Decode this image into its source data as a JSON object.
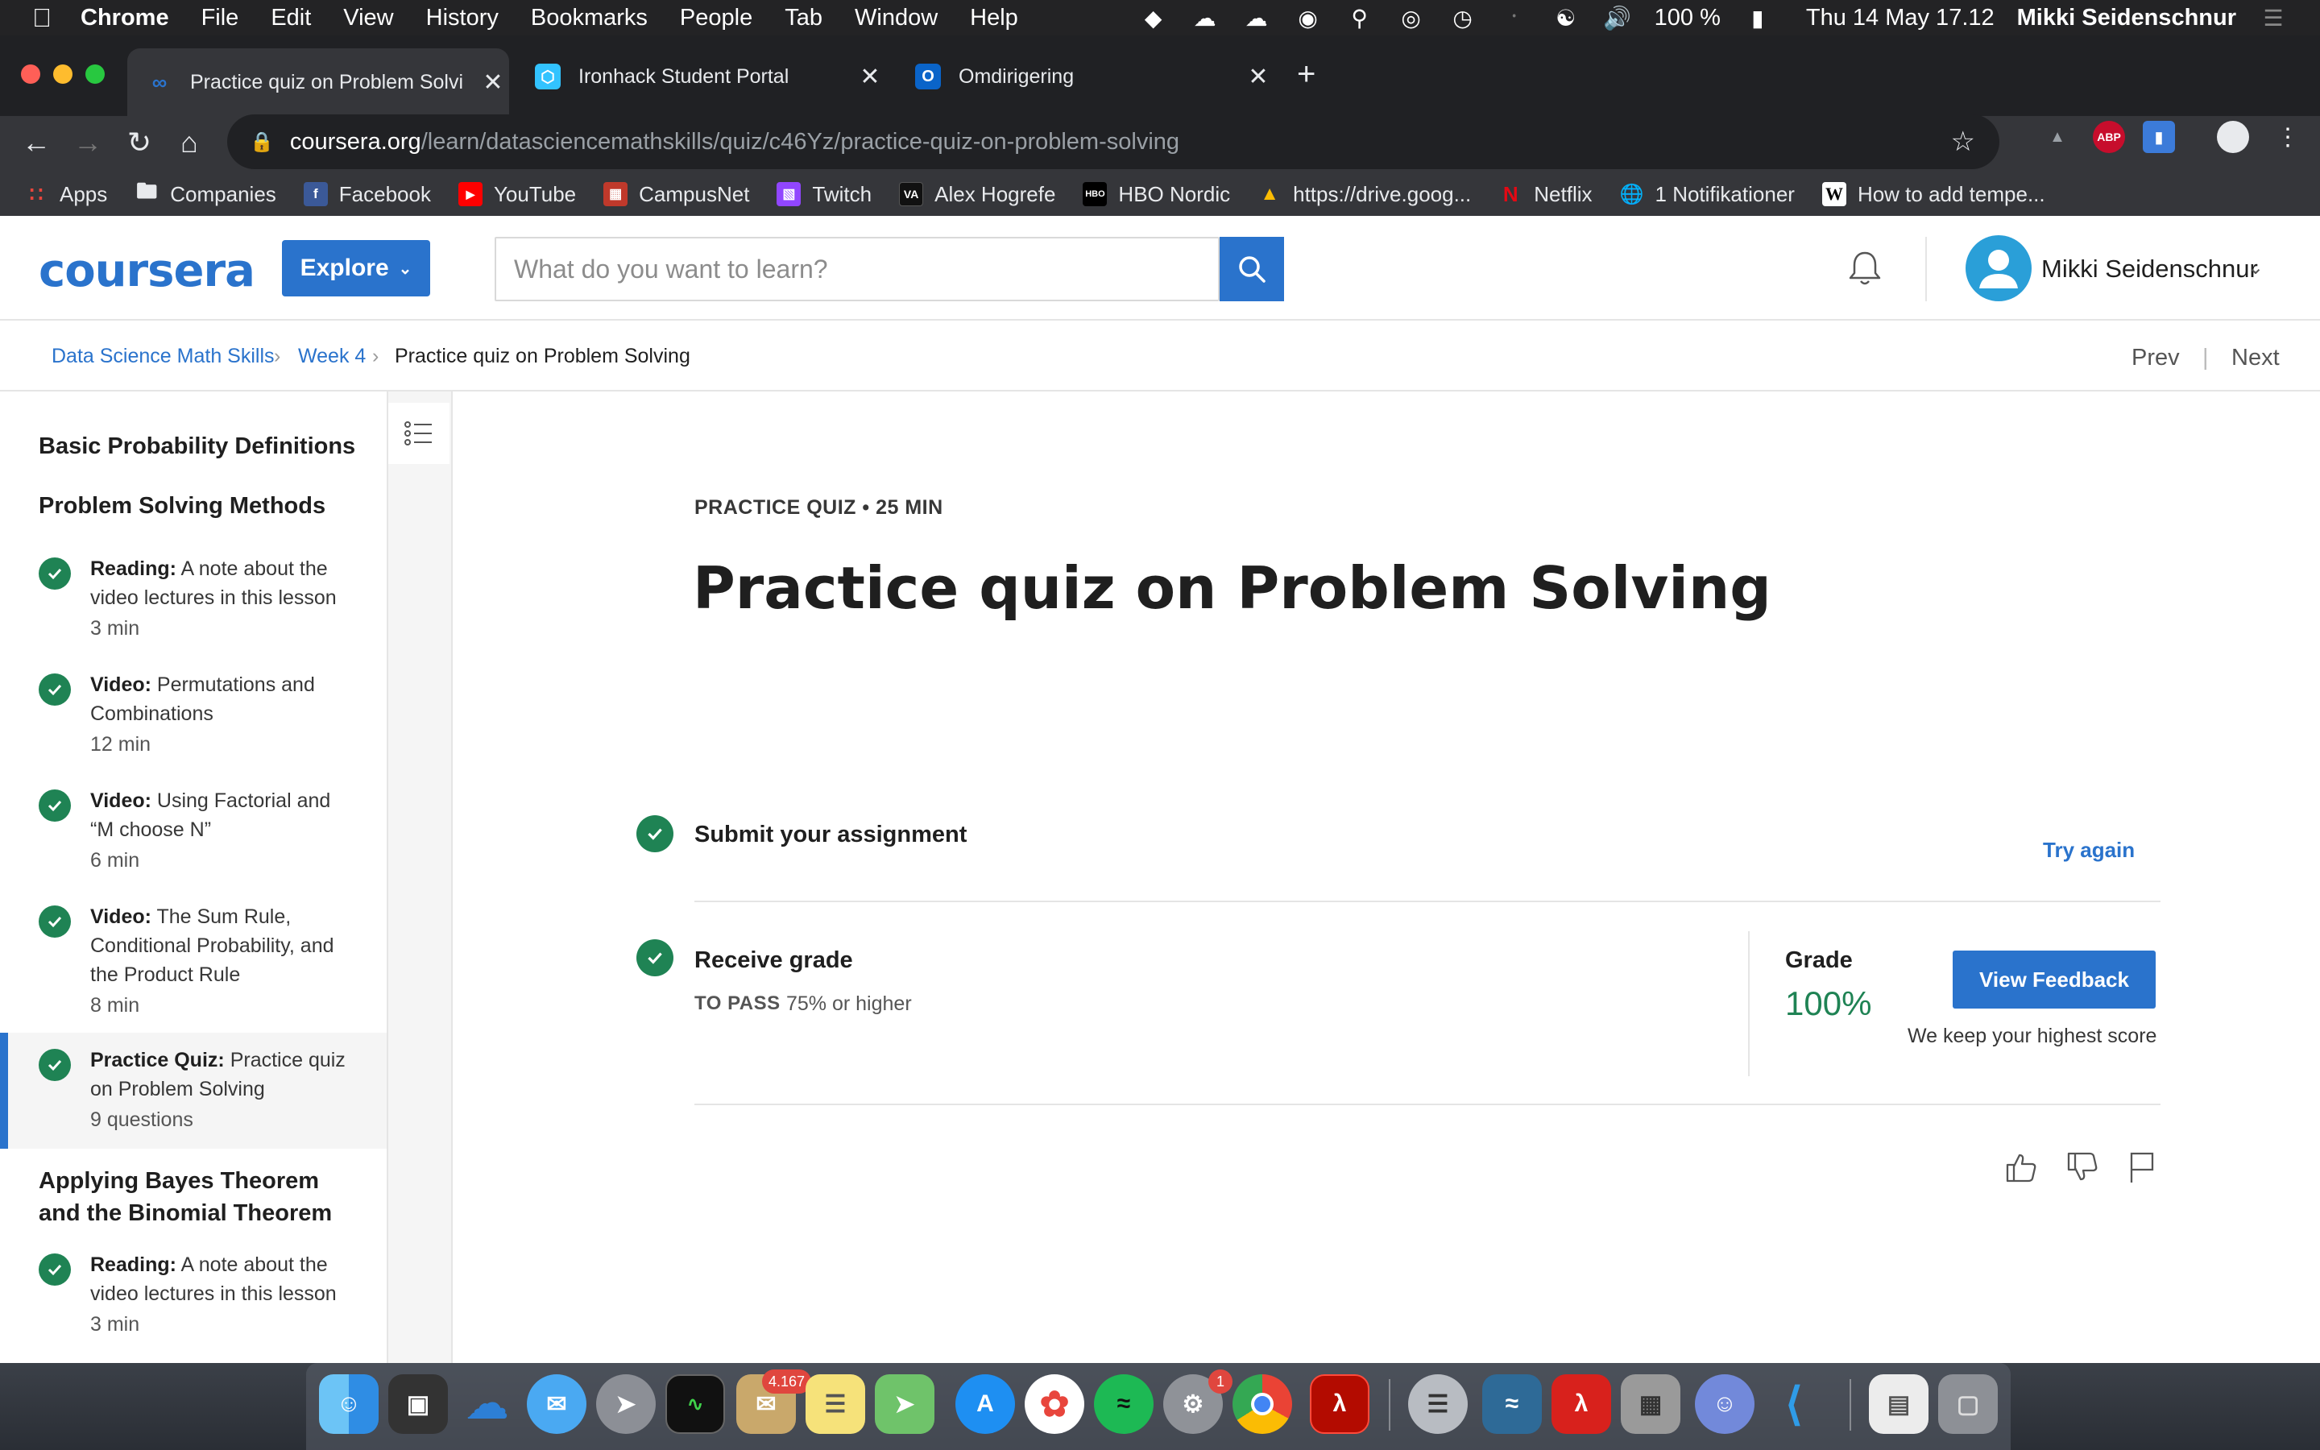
{
  "menubar": {
    "app_name": "Chrome",
    "menus": [
      "File",
      "Edit",
      "View",
      "History",
      "Bookmarks",
      "People",
      "Tab",
      "Window",
      "Help"
    ],
    "battery": "100 %",
    "datetime": "Thu 14 May  17.12",
    "user": "Mikki Seidenschnur"
  },
  "tabs": [
    {
      "title": "Practice quiz on Problem Solvi",
      "icon": "coursera-icon",
      "active": true
    },
    {
      "title": "Ironhack Student Portal",
      "icon": "ironhack-icon",
      "active": false
    },
    {
      "title": "Omdirigering",
      "icon": "outlook-icon",
      "active": false
    }
  ],
  "omnibox": {
    "host": "coursera.org",
    "path": "/learn/datasciencemathskills/quiz/c46Yz/practice-quiz-on-problem-solving"
  },
  "bookmarks": [
    {
      "label": "Apps",
      "icon": "apps-grid-icon",
      "color": "#e8453c"
    },
    {
      "label": "Companies",
      "icon": "folder-icon",
      "color": "#9aa0a6"
    },
    {
      "label": "Facebook",
      "icon": "facebook-icon",
      "color": "#3b5998"
    },
    {
      "label": "YouTube",
      "icon": "youtube-icon",
      "color": "#ff0000"
    },
    {
      "label": "CampusNet",
      "icon": "campusnet-icon",
      "color": "#c0392b"
    },
    {
      "label": "Twitch",
      "icon": "twitch-icon",
      "color": "#9146ff"
    },
    {
      "label": "Alex Hogrefe",
      "icon": "va-icon",
      "color": "#111111"
    },
    {
      "label": "HBO Nordic",
      "icon": "hbo-icon",
      "color": "#000000"
    },
    {
      "label": "https://drive.goog...",
      "icon": "google-drive-icon",
      "color": "#fbbc04"
    },
    {
      "label": "Netflix",
      "icon": "netflix-icon",
      "color": "#e50914"
    },
    {
      "label": "1 Notifikationer",
      "icon": "globe-icon",
      "color": "#e8eaed"
    },
    {
      "label": "How to add tempe...",
      "icon": "wikipedia-icon",
      "color": "#ffffff"
    }
  ],
  "header": {
    "logo": "coursera",
    "explore_label": "Explore",
    "search_placeholder": "What do you want to learn?",
    "user_name": "Mikki Seidenschnur"
  },
  "breadcrumb": {
    "items": [
      "Data Science Math Skills",
      "Week 4",
      "Practice quiz on Problem Solving"
    ],
    "prev": "Prev",
    "next": "Next"
  },
  "sidebar": {
    "sections": [
      "Basic Probability Definitions",
      "Problem Solving Methods",
      "Applying Bayes Theorem and the Binomial Theorem"
    ],
    "items": [
      {
        "kind": "Reading:",
        "title": "A note about the video lectures in this lesson",
        "duration": "3 min"
      },
      {
        "kind": "Video:",
        "title": "Permutations and Combinations",
        "duration": "12 min"
      },
      {
        "kind": "Video:",
        "title": "Using Factorial and “M choose N”",
        "duration": "6 min"
      },
      {
        "kind": "Video:",
        "title": "The Sum Rule, Conditional Probability, and the Product Rule",
        "duration": "8 min"
      },
      {
        "kind": "Practice Quiz:",
        "title": "Practice quiz on Problem Solving",
        "duration": "9 questions"
      },
      {
        "kind": "Reading:",
        "title": "A note about the video lectures in this lesson",
        "duration": "3 min"
      }
    ]
  },
  "quiz": {
    "eyebrow": "PRACTICE QUIZ • 25 MIN",
    "title": "Practice quiz on Problem Solving",
    "step1": "Submit your assignment",
    "try_again": "Try again",
    "step2": "Receive grade",
    "to_pass_label": "TO PASS",
    "to_pass_value": "75% or higher",
    "grade_label": "Grade",
    "grade_value": "100%",
    "feedback_label": "View Feedback",
    "keep_note": "We keep your highest score"
  },
  "dock": {
    "mail_badge": "4.167",
    "prefs_badge": "1"
  },
  "colors": {
    "accent": "#2a73cc",
    "success": "#1f8354"
  }
}
